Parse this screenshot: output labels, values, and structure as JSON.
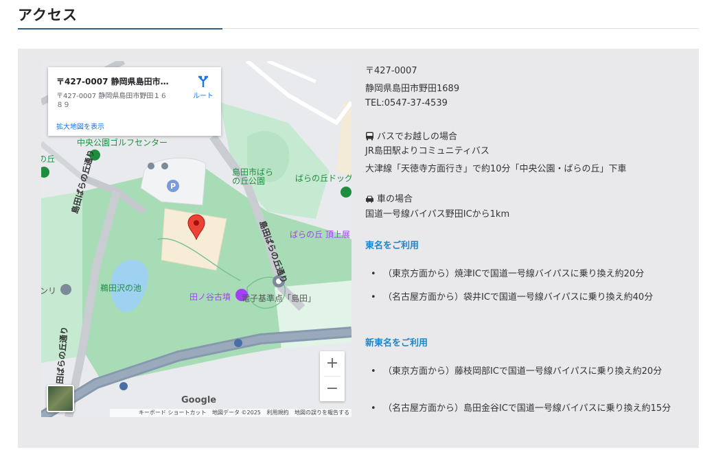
{
  "heading": "アクセス",
  "map": {
    "card_title": "〒427-0007 静岡県島田市野田...",
    "card_address": "〒427-0007 静岡県島田市野田１６８９",
    "card_link": "拡大地図を表示",
    "route_label": "ルート",
    "labels": {
      "golf": "中央公園ゴルフセンター",
      "barapark": "島田市ばら\nの丘公園",
      "dogrun": "ばらの丘ドッグラ",
      "hilltop": "ばらの丘 頂上展",
      "pond": "鵜田沢の池",
      "tomb": "田ノ谷古墳",
      "benchmark": "電子基準点「島田」",
      "road1": "島田ばらの丘通り",
      "road2": "島田ばらの丘通り",
      "road3": "田ばらの丘通り",
      "left1": "の丘",
      "left2": "ンリ"
    },
    "zoom_in": "+",
    "zoom_out": "−",
    "google": "Google",
    "attribution": [
      "キーボード ショートカット",
      "地図データ ©2025",
      "利用規約",
      "地図の誤りを報告する"
    ]
  },
  "info": {
    "postal": "〒427-0007",
    "address": "静岡県島田市野田1689",
    "tel": "TEL:0547-37-4539",
    "bus_heading": "バスでお越しの場合",
    "bus_line1": "JR島田駅よりコミュニティバス",
    "bus_line2": "大津線「天徳寺方面行き」で約10分「中央公園・ばらの丘」下車",
    "car_heading": "車の場合",
    "car_line1": "国道一号線バイパス野田ICから1km",
    "tomei_heading": "東名をご利用",
    "tomei_items": [
      "（東京方面から）焼津ICで国道一号線バイパスに乗り換え約20分",
      "（名古屋方面から）袋井ICで国道一号線バイパスに乗り換え約40分"
    ],
    "shintomei_heading": "新東名をご利用",
    "shintomei_items": [
      "（東京方面から）藤枝岡部ICで国道一号線バイパスに乗り換え約20分",
      "（名古屋方面から）島田金谷ICで国道一号線バイパスに乗り換え約15分"
    ]
  },
  "colors": {
    "accent": "#1d86c8",
    "rule": "#2f5d8a",
    "panel": "#e9e9ec",
    "pin": "#ea4335"
  }
}
